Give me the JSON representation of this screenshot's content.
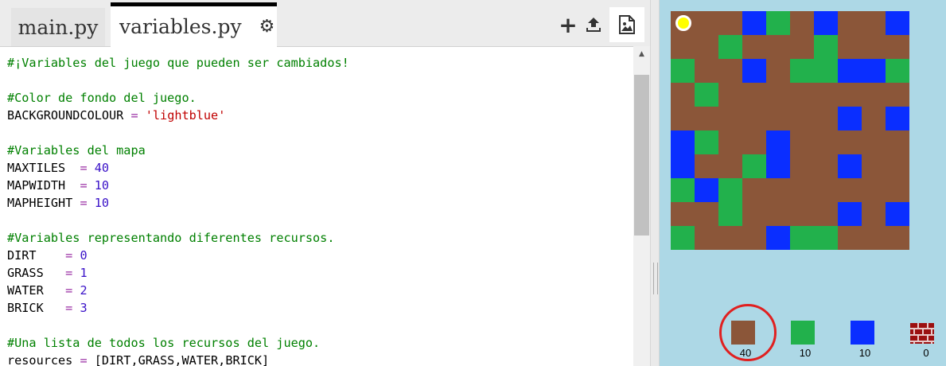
{
  "tabs": [
    {
      "label": "main.py",
      "active": false
    },
    {
      "label": "variables.py",
      "active": true
    }
  ],
  "icons": {
    "settings": "gear-icon",
    "add_file": "plus-icon",
    "upload": "upload-icon",
    "image": "image-icon"
  },
  "code_lines": [
    [
      {
        "t": "c",
        "v": "#¡Variables del juego que pueden ser cambiados!"
      }
    ],
    [],
    [
      {
        "t": "c",
        "v": "#Color de fondo del juego."
      }
    ],
    [
      {
        "t": "p",
        "v": "BACKGROUNDCOLOUR "
      },
      {
        "t": "o",
        "v": "="
      },
      {
        "t": "p",
        "v": " "
      },
      {
        "t": "s",
        "v": "'lightblue'"
      }
    ],
    [],
    [
      {
        "t": "c",
        "v": "#Variables del mapa"
      }
    ],
    [
      {
        "t": "p",
        "v": "MAXTILES  "
      },
      {
        "t": "o",
        "v": "="
      },
      {
        "t": "p",
        "v": " "
      },
      {
        "t": "n",
        "v": "40"
      }
    ],
    [
      {
        "t": "p",
        "v": "MAPWIDTH  "
      },
      {
        "t": "o",
        "v": "="
      },
      {
        "t": "p",
        "v": " "
      },
      {
        "t": "n",
        "v": "10"
      }
    ],
    [
      {
        "t": "p",
        "v": "MAPHEIGHT "
      },
      {
        "t": "o",
        "v": "="
      },
      {
        "t": "p",
        "v": " "
      },
      {
        "t": "n",
        "v": "10"
      }
    ],
    [],
    [
      {
        "t": "c",
        "v": "#Variables representando diferentes recursos."
      }
    ],
    [
      {
        "t": "p",
        "v": "DIRT    "
      },
      {
        "t": "o",
        "v": "="
      },
      {
        "t": "p",
        "v": " "
      },
      {
        "t": "n",
        "v": "0"
      }
    ],
    [
      {
        "t": "p",
        "v": "GRASS   "
      },
      {
        "t": "o",
        "v": "="
      },
      {
        "t": "p",
        "v": " "
      },
      {
        "t": "n",
        "v": "1"
      }
    ],
    [
      {
        "t": "p",
        "v": "WATER   "
      },
      {
        "t": "o",
        "v": "="
      },
      {
        "t": "p",
        "v": " "
      },
      {
        "t": "n",
        "v": "2"
      }
    ],
    [
      {
        "t": "p",
        "v": "BRICK   "
      },
      {
        "t": "o",
        "v": "="
      },
      {
        "t": "p",
        "v": " "
      },
      {
        "t": "n",
        "v": "3"
      }
    ],
    [],
    [
      {
        "t": "c",
        "v": "#Una lista de todos los recursos del juego."
      }
    ],
    [
      {
        "t": "p",
        "v": "resources "
      },
      {
        "t": "o",
        "v": "="
      },
      {
        "t": "p",
        "v": " [DIRT,GRASS,WATER,BRICK]"
      }
    ]
  ],
  "colors": {
    "background": "#add8e6",
    "dirt": "#8b5639",
    "grass": "#22b14c",
    "water": "#0a2eff",
    "player": "#ffff00",
    "highlight": "#e02020"
  },
  "map_grid": [
    [
      0,
      0,
      0,
      2,
      1,
      0,
      2,
      0,
      0,
      2
    ],
    [
      0,
      0,
      1,
      0,
      0,
      0,
      1,
      0,
      0,
      0
    ],
    [
      1,
      0,
      0,
      2,
      0,
      1,
      1,
      2,
      2,
      1
    ],
    [
      0,
      1,
      0,
      0,
      0,
      0,
      0,
      0,
      0,
      0
    ],
    [
      0,
      0,
      0,
      0,
      0,
      0,
      0,
      2,
      0,
      2
    ],
    [
      2,
      1,
      0,
      0,
      2,
      0,
      0,
      0,
      0,
      0
    ],
    [
      2,
      0,
      0,
      1,
      2,
      0,
      0,
      2,
      0,
      0
    ],
    [
      1,
      2,
      1,
      0,
      0,
      0,
      0,
      0,
      0,
      0
    ],
    [
      0,
      0,
      1,
      0,
      0,
      0,
      0,
      2,
      0,
      2
    ],
    [
      1,
      0,
      0,
      0,
      2,
      1,
      1,
      0,
      0,
      0
    ]
  ],
  "player_position": {
    "row": 0,
    "col": 0
  },
  "inventory": [
    {
      "resource": "dirt",
      "count": "40",
      "selected": true
    },
    {
      "resource": "grass",
      "count": "10",
      "selected": false
    },
    {
      "resource": "water",
      "count": "10",
      "selected": false
    },
    {
      "resource": "brick",
      "count": "0",
      "selected": false
    }
  ]
}
